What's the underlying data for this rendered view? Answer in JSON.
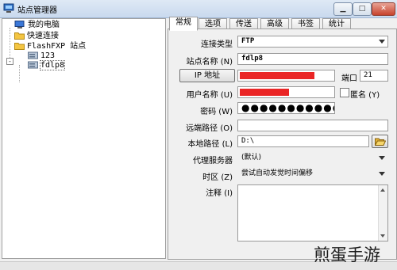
{
  "window": {
    "title": "站点管理器",
    "controls": {
      "minimize": "▁",
      "maximize": "□",
      "close": "✕"
    }
  },
  "tree": {
    "items": [
      {
        "label": "我的电脑",
        "icon": "computer-icon"
      },
      {
        "label": "快速连接",
        "icon": "folder-icon"
      },
      {
        "label": "FlashFXP 站点",
        "icon": "folder-icon",
        "expander": "-"
      },
      {
        "label": "123",
        "icon": "server-icon"
      },
      {
        "label": "fdlp8",
        "icon": "server-icon",
        "selected": true
      }
    ]
  },
  "tabs": [
    {
      "label": "常规",
      "active": true
    },
    {
      "label": "选项"
    },
    {
      "label": "传送"
    },
    {
      "label": "高级"
    },
    {
      "label": "书签"
    },
    {
      "label": "统计"
    }
  ],
  "form": {
    "connection_type": {
      "label": "连接类型",
      "value": "FTP"
    },
    "site_name": {
      "label": "站点名称 (N)",
      "value": "fdlp8"
    },
    "ip_button": "IP 地址",
    "ip_value": "",
    "port": {
      "label": "端口",
      "value": "21"
    },
    "username": {
      "label": "用户名称 (U)",
      "value": ""
    },
    "anonymous": {
      "label": "匿名 (Y)",
      "checked": false
    },
    "password": {
      "label": "密码 (W)",
      "value": "●●●●●●●●●●●"
    },
    "remote_path": {
      "label": "远端路径 (O)",
      "value": ""
    },
    "local_path": {
      "label": "本地路径 (L)",
      "value": "D:\\"
    },
    "proxy": {
      "label": "代理服务器",
      "value": "(默认)"
    },
    "timezone": {
      "label": "时区 (Z)",
      "value": "尝试自动发觉时间偏移"
    },
    "notes": {
      "label": "注释 (I)",
      "value": ""
    }
  },
  "watermark": "煎蛋手游",
  "colors": {
    "redaction": "#ea2525",
    "title_gradient_top": "#dfe9f5",
    "close_button": "#c7432d"
  }
}
